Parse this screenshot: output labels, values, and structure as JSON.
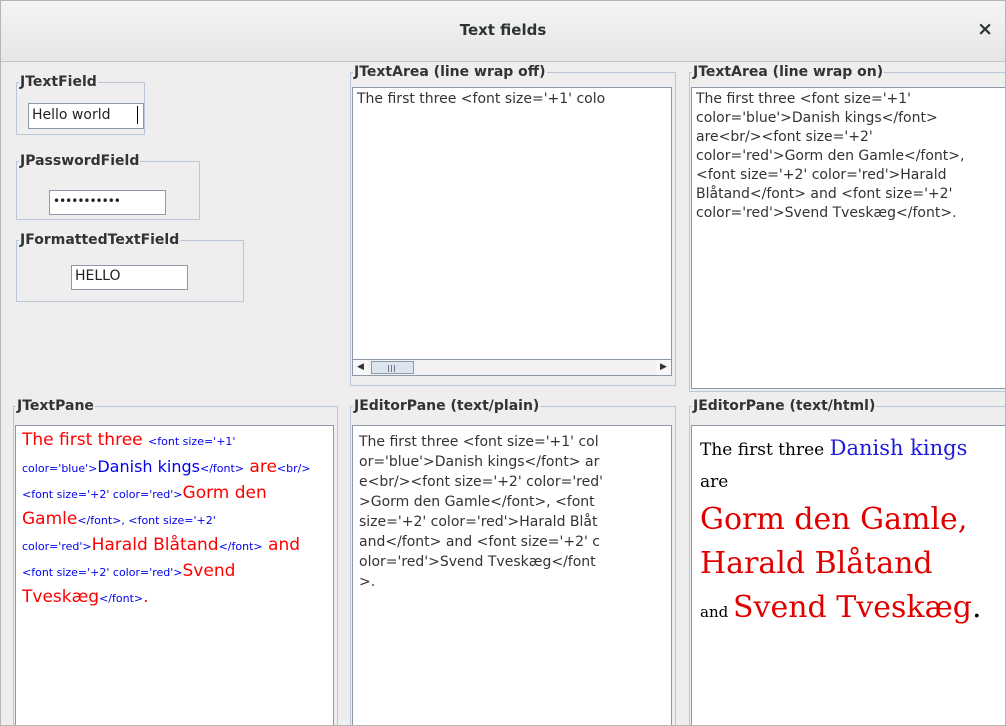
{
  "window": {
    "title": "Text fields",
    "close_glyph": "×"
  },
  "groups": {
    "textfield_title": "JTextField",
    "password_title": "JPasswordField",
    "formatted_title": "JFormattedTextField",
    "textarea_nowrap_title": "JTextArea (line wrap off)",
    "textarea_wrap_title": "JTextArea (line wrap on)",
    "textpane_title": "JTextPane",
    "editor_plain_title": "JEditorPane (text/plain)",
    "editor_html_title": "JEditorPane (text/html)"
  },
  "fields": {
    "textfield_value": "Hello world",
    "password_mask": "•••••••••••",
    "formatted_value": "HELLO"
  },
  "source_text": "The first three <font size='+1' color='blue'>Danish kings</font> are<br/><font size='+2' color='red'>Gorm den Gamle</font>, <font size='+2' color='red'>Harald Blåtand</font> and <font size='+2' color='red'>Svend Tveskæg</font>.",
  "nowrap_visible": "The first three <font size='+1' colo",
  "plain_lines": [
    "The first three <font size='+1' col",
    "or='blue'>Danish kings</font> ar",
    "e<br/><font size='+2' color='red'",
    ">Gorm den Gamle</font>, <font",
    "size='+2' color='red'>Harald Blåt",
    "and</font> and <font size='+2' c",
    "olor='red'>Svend Tveskæg</font",
    ">."
  ],
  "pane": {
    "p1": "The first three ",
    "t1": "<font size='+1' color='blue'>",
    "p2": "Danish kings",
    "t2": "</font>",
    "p3": " are",
    "t3": "<br/><font size='+2' color='red'>",
    "p4": "Gorm den Gamle",
    "t4": "</font>, <font size='+2' color='red'>",
    "p5": "Harald Blåtand",
    "t5": "</font>",
    "p6": " and ",
    "t6": "<font size='+2' color='red'>",
    "p7": "Svend Tveskæg",
    "t7": "</font>",
    "p8": "."
  },
  "html_render": {
    "intro": "The first three ",
    "kings": "Danish kings",
    "are": " are",
    "king1": "Gorm den Gamle",
    "comma": ",",
    "king2": "Harald Blåtand",
    "and": "and ",
    "king3": "Svend Tveskæg",
    "period": "."
  },
  "scrollbar": {
    "left_arrow": "◀",
    "right_arrow": "▶"
  },
  "colors": {
    "border": "#b9c7d8",
    "blue_text": "#0000ee",
    "red_text": "#ff0000"
  }
}
